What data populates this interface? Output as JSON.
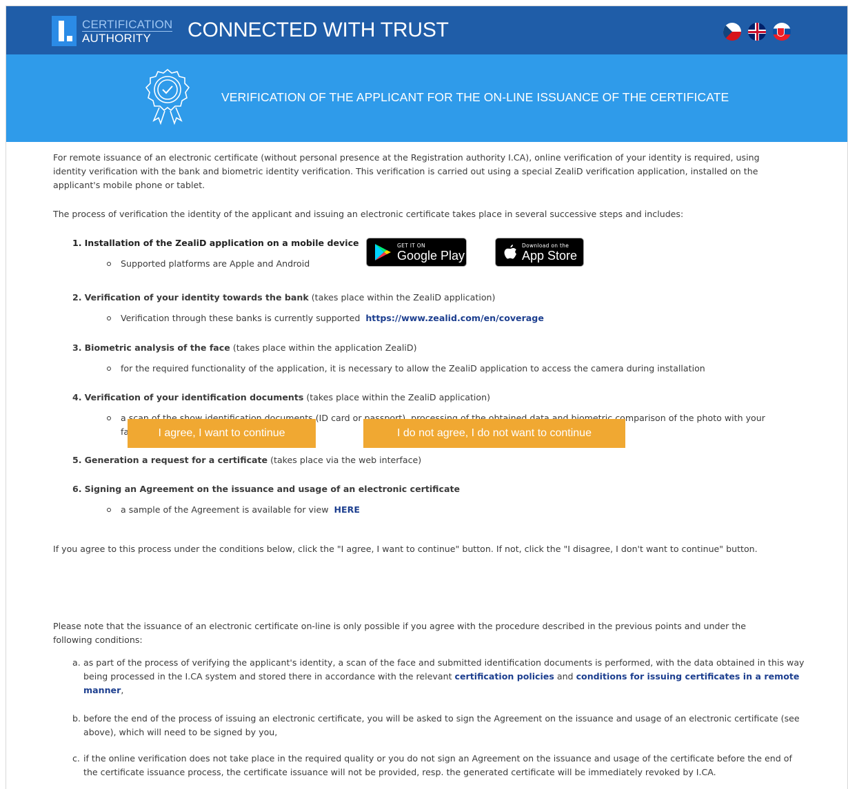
{
  "header": {
    "logo_line1": "CERTIFICATION",
    "logo_line2": "AUTHORITY",
    "slogan": "CONNECTED WITH TRUST",
    "colors": {
      "header_bg": "#1f5da8",
      "hero_bg": "#2f9bea",
      "button_bg": "#f0a832",
      "link": "#1d3f8f"
    }
  },
  "hero": {
    "title": "VERIFICATION OF THE APPLICANT FOR THE ON-LINE ISSUANCE OF THE CERTIFICATE",
    "icon": "certificate-badge-icon"
  },
  "intro": {
    "p1": "For remote issuance of an electronic certificate (without personal presence at the Registration authority I.CA), online verification of your identity is required, using identity verification with the bank and biometric identity verification. This verification is carried out using a special ZealiD verification application, installed on the applicant's mobile phone or tablet.",
    "p2": "The process of verification the identity of the applicant and issuing an electronic certificate takes place in several successive steps and includes:"
  },
  "steps": [
    {
      "num": "1.",
      "title": "Installation of the ZealiD application on a mobile device",
      "note": "",
      "bullet": "Supported platforms are Apple and Android"
    },
    {
      "num": "2.",
      "title": "Verification of your identity towards the bank",
      "note": "(takes place within the ZealiD application)",
      "bullet": "Verification through these banks is currently supported",
      "link": "https://www.zealid.com/en/coverage"
    },
    {
      "num": "3.",
      "title": "Biometric analysis of the face",
      "note": "(takes place within the application ZealiD)",
      "bullet": "for the required functionality of the application, it is necessary to allow the ZealiD application to access the camera during installation"
    },
    {
      "num": "4.",
      "title": "Verification of your identification documents",
      "note": "(takes place within the ZealiD application)",
      "bullet": "a scan of the show identification documents (ID card or passport), processing of the obtained data and biometric comparison of the photo with your face is performed"
    },
    {
      "num": "5.",
      "title": "Generation a request for a certificate",
      "note": "(takes place via the web interface)"
    },
    {
      "num": "6.",
      "title": "Signing an Agreement on the issuance and usage of an electronic certificate",
      "note": "",
      "bullet": "a sample of the Agreement is available for view",
      "link": "HERE"
    }
  ],
  "stores": {
    "google_small": "GET IT ON",
    "google_big": "Google Play",
    "apple_small": "Download on the",
    "apple_big": "App Store"
  },
  "agree_text": "If you agree to this process under the conditions below, click the \"I agree, I want to continue\" button. If not, click the \"I disagree, I don't want to continue\" button.",
  "buttons": {
    "agree": "I agree, I want to continue",
    "disagree": "I do not agree, I do not want to continue"
  },
  "note": "Please note that the issuance of an electronic certificate on-line is only possible if you agree with the procedure described in the previous points and under the following conditions:",
  "conditions": [
    {
      "letter": "a.",
      "text": "as part of the process of verifying the applicant's identity, a scan of the face and submitted identification documents is performed, with the data obtained in this way being processed in the I.CA system and stored there in accordance with the relevant",
      "link1": "certification policies",
      "and": "and",
      "link2": "conditions for issuing certificates in a remote manner",
      "end": ","
    },
    {
      "letter": "b.",
      "text": "before the end of the process of issuing an electronic certificate, you will be asked to sign the Agreement on the issuance and usage of an electronic certificate (see above), which will need to be signed by you,"
    },
    {
      "letter": "c.",
      "text": "if the online verification does not take place in the required quality or you do not sign an Agreement on the issuance and usage of the certificate before the end of the certificate issuance process, the certificate issuance will not be provided, resp. the generated certificate will be immediately revoked by I.CA."
    }
  ]
}
